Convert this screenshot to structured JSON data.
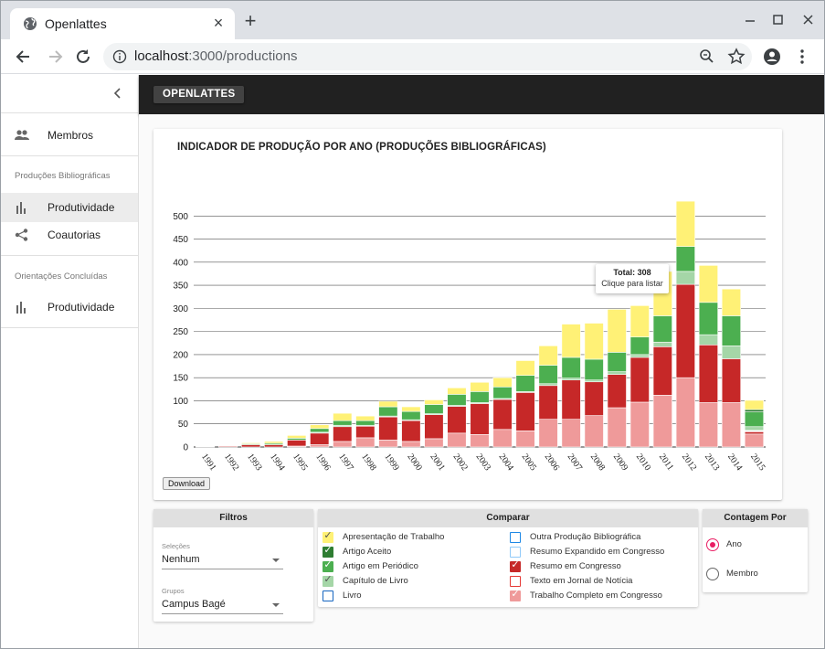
{
  "browser": {
    "tab_title": "Openlattes",
    "url_host": "localhost",
    "url_path": ":3000/productions"
  },
  "sidebar": {
    "items": [
      {
        "label": "Membros",
        "icon": "people-icon"
      },
      {
        "section": "Produções Bibliográficas"
      },
      {
        "label": "Produtividade",
        "icon": "bar-chart-icon",
        "active": true
      },
      {
        "label": "Coautorias",
        "icon": "share-icon"
      },
      {
        "section": "Orientações Concluídas"
      },
      {
        "label": "Produtividade",
        "icon": "bar-chart-icon"
      }
    ]
  },
  "appbar": {
    "brand": "OPENLATTES"
  },
  "card": {
    "title": "INDICADOR DE PRODUÇÃO POR ANO (PRODUÇÕES BIBLIOGRÁFICAS)",
    "download_label": "Download",
    "tooltip": {
      "total": "Total: 308",
      "hint": "Clique para listar"
    }
  },
  "chart_data": {
    "type": "bar",
    "stacked": true,
    "title": "INDICADOR DE PRODUÇÃO POR ANO (PRODUÇÕES BIBLIOGRÁFICAS)",
    "ylim": [
      0,
      550
    ],
    "yticks": [
      0,
      50,
      100,
      150,
      200,
      250,
      300,
      350,
      400,
      450,
      500
    ],
    "grid": true,
    "categories": [
      "1991",
      "1992",
      "1993",
      "1994",
      "1995",
      "1996",
      "1997",
      "1998",
      "1999",
      "2000",
      "2001",
      "2002",
      "2003",
      "2004",
      "2005",
      "2006",
      "2007",
      "2008",
      "2009",
      "2010",
      "2011",
      "2012",
      "2013",
      "2014",
      "2015"
    ],
    "series": [
      {
        "name": "Trabalho Completo em Congresso",
        "color": "#ef9a9a",
        "values": [
          0,
          0,
          0,
          0,
          2,
          5,
          12,
          20,
          15,
          12,
          18,
          30,
          27,
          38,
          35,
          60,
          60,
          68,
          85,
          97,
          112,
          150,
          96,
          96,
          28
        ]
      },
      {
        "name": "Resumo em Congresso",
        "color": "#c62828",
        "values": [
          1,
          2,
          5,
          5,
          13,
          25,
          32,
          25,
          50,
          45,
          52,
          58,
          67,
          65,
          83,
          73,
          85,
          73,
          72,
          97,
          105,
          202,
          125,
          95,
          5
        ]
      },
      {
        "name": "Texto em Jornal de Notícia",
        "color": "#ffffff",
        "values": [
          0,
          0,
          0,
          0,
          0,
          0,
          0,
          0,
          0,
          0,
          0,
          0,
          0,
          0,
          0,
          0,
          0,
          0,
          0,
          0,
          0,
          0,
          0,
          0,
          3
        ]
      },
      {
        "name": "Capítulo de Livro",
        "color": "#a5d6a7",
        "values": [
          0,
          0,
          0,
          0,
          0,
          2,
          3,
          2,
          2,
          2,
          2,
          2,
          2,
          2,
          2,
          4,
          4,
          4,
          6,
          6,
          10,
          28,
          22,
          28,
          8
        ]
      },
      {
        "name": "Artigo em Periódico",
        "color": "#4caf50",
        "values": [
          0,
          0,
          2,
          3,
          4,
          8,
          10,
          10,
          20,
          18,
          20,
          24,
          24,
          25,
          35,
          40,
          45,
          45,
          42,
          38,
          57,
          54,
          70,
          65,
          32
        ]
      },
      {
        "name": "Artigo Aceito",
        "color": "#2e7d32",
        "values": [
          0,
          0,
          0,
          0,
          0,
          0,
          0,
          0,
          0,
          0,
          0,
          0,
          0,
          0,
          0,
          0,
          0,
          0,
          0,
          0,
          0,
          0,
          0,
          0,
          5
        ]
      },
      {
        "name": "Apresentação de Trabalho",
        "color": "#fff176",
        "values": [
          1,
          1,
          2,
          4,
          6,
          8,
          16,
          10,
          12,
          10,
          10,
          14,
          20,
          20,
          32,
          42,
          72,
          78,
          93,
          68,
          96,
          98,
          80,
          58,
          20
        ]
      }
    ]
  },
  "filters": {
    "title": "Filtros",
    "selecoes_label": "Seleções",
    "selecoes_value": "Nenhum",
    "grupos_label": "Grupos",
    "grupos_value": "Campus Bagé"
  },
  "compare": {
    "title": "Comparar",
    "items": [
      {
        "label": "Apresentação de Trabalho",
        "color": "#fff176",
        "checked": true
      },
      {
        "label": "Artigo Aceito",
        "color": "#2e7d32",
        "checked": true
      },
      {
        "label": "Artigo em Periódico",
        "color": "#4caf50",
        "checked": true
      },
      {
        "label": "Capítulo de Livro",
        "color": "#a5d6a7",
        "checked": true
      },
      {
        "label": "Livro",
        "color": "#1565c0",
        "checked": false
      },
      {
        "label": "Outra Produção Bibliográfica",
        "color": "#1e88e5",
        "checked": false
      },
      {
        "label": "Resumo Expandido em Congresso",
        "color": "#90caf9",
        "checked": false
      },
      {
        "label": "Resumo em Congresso",
        "color": "#c62828",
        "checked": true
      },
      {
        "label": "Texto em Jornal de Notícia",
        "color": "#e53935",
        "checked": false
      },
      {
        "label": "Trabalho Completo em Congresso",
        "color": "#ef9a9a",
        "checked": true
      }
    ]
  },
  "count_by": {
    "title": "Contagem Por",
    "options": [
      {
        "label": "Ano",
        "selected": true
      },
      {
        "label": "Membro",
        "selected": false
      }
    ]
  }
}
